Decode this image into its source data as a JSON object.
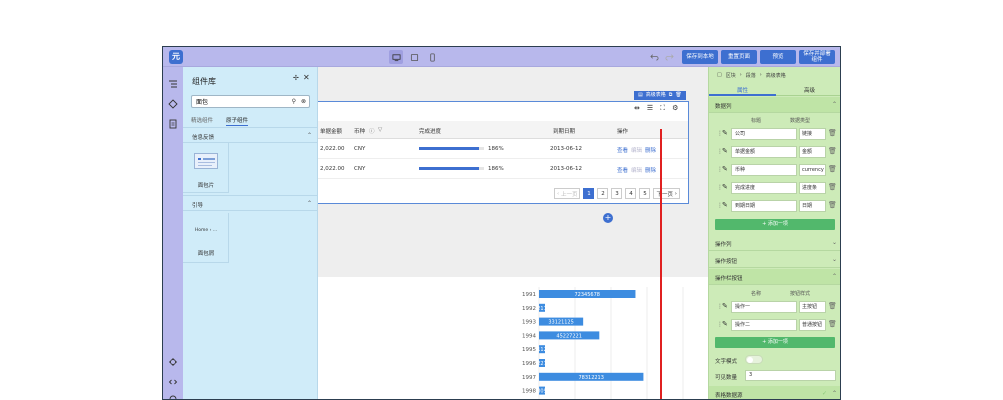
{
  "toolbar": {
    "logo": "元",
    "buttons": [
      "保存到本地",
      "重置页面",
      "预览",
      "保存并部署组件"
    ]
  },
  "library": {
    "title": "组件库",
    "search_value": "面包",
    "tabs": [
      "精选组件",
      "原子组件"
    ],
    "sections": [
      {
        "title": "信息反馈",
        "items": [
          "面包片"
        ]
      },
      {
        "title": "引导",
        "items": [
          "面包屑"
        ]
      }
    ],
    "breadcrumb_preview": "Home › ..."
  },
  "table": {
    "block_label": "高级表格",
    "headers": [
      "单据金额",
      "币种",
      "完成进度",
      "到期日期",
      "操作"
    ],
    "rows": [
      {
        "amount": "2,022.00",
        "currency": "CNY",
        "progress": 0.186,
        "progress_text": "186%",
        "date": "2013-06-12",
        "ops": [
          "查看",
          "编辑",
          "删除"
        ]
      },
      {
        "amount": "2,022.00",
        "currency": "CNY",
        "progress": 0.186,
        "progress_text": "186%",
        "date": "2013-06-12",
        "ops": [
          "查看",
          "编辑",
          "删除"
        ]
      }
    ],
    "pager": {
      "prev": "上一页",
      "pages": [
        "1",
        "2",
        "3",
        "4",
        "5"
      ],
      "next": "下一页",
      "current": "1"
    }
  },
  "chart_data": {
    "type": "bar",
    "categories": [
      "1991",
      "1992",
      "1993",
      "1994",
      "1995",
      "1996",
      "1997",
      "1998"
    ],
    "values": [
      72345678,
      2000000,
      33121125,
      45227221,
      2200000,
      3800000,
      78312213,
      2000000
    ],
    "data_labels": [
      "72345678",
      "211",
      "33121125",
      "45227221",
      "112",
      "227",
      "78312213",
      "309"
    ],
    "xlim": [
      0,
      105000000
    ]
  },
  "props": {
    "breadcrumb": [
      "区块",
      "段落",
      "高级表格"
    ],
    "tabs": [
      "属性",
      "高级"
    ],
    "data_columns": {
      "title": "数据列",
      "headers": [
        "标题",
        "数据类型"
      ],
      "rows": [
        {
          "name": "公司",
          "type": "链接"
        },
        {
          "name": "单据金额",
          "type": "金额"
        },
        {
          "name": "币种",
          "type": "currency"
        },
        {
          "name": "完成进度",
          "type": "进度条"
        },
        {
          "name": "到期日期",
          "type": "日期"
        }
      ],
      "add": "+ 添加一项"
    },
    "sections_collapsed": [
      "操作列",
      "操作按钮"
    ],
    "row_buttons": {
      "title": "操作栏按钮",
      "headers": [
        "名称",
        "按钮样式"
      ],
      "rows": [
        {
          "name": "操作一",
          "type": "主按钮"
        },
        {
          "name": "操作二",
          "type": "普通按钮"
        }
      ],
      "add": "+ 添加一项"
    },
    "text_mode_label": "文字模式",
    "visible_count_label": "可见数量",
    "visible_count_value": "3",
    "data_source_title": "表格数据源"
  },
  "colors": {
    "accent": "#3d6fd0",
    "library_bg": "#d0ecf9",
    "props_bg": "#cdebb8",
    "topbar_bg": "#b8b8ec",
    "guide": "#e02020"
  }
}
